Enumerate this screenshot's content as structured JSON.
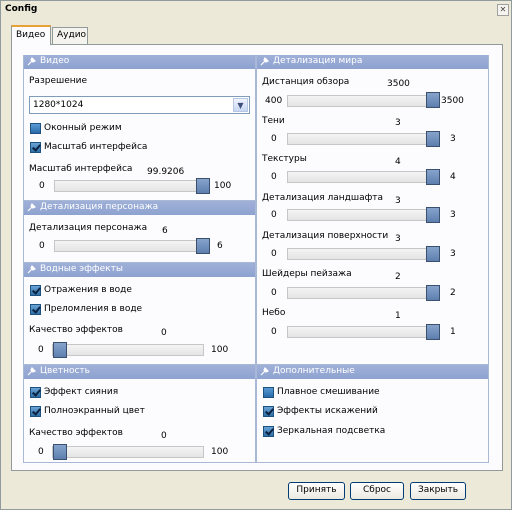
{
  "window": {
    "title": "Config",
    "close_glyph": "✕"
  },
  "tabs": [
    {
      "label": "Видео",
      "active": true
    },
    {
      "label": "Аудио",
      "active": false
    }
  ],
  "video": {
    "header": "Видео",
    "resolution_label": "Разрешение",
    "resolution_value": "1280*1024",
    "windowed_label": "Оконный режим",
    "ui_scale_check_label": "Масштаб интерфейса",
    "ui_scale_slider_label": "Масштаб интерфейса",
    "ui_scale": {
      "value": "99.9206",
      "min": "0",
      "max": "100"
    }
  },
  "character": {
    "header": "Детализация персонажа",
    "label": "Детализация персонажа",
    "slider": {
      "value": "6",
      "min": "0",
      "max": "6"
    }
  },
  "water": {
    "header": "Водные эффекты",
    "reflections_label": "Отражения в воде",
    "refractions_label": "Преломления в воде",
    "quality_label": "Качество эффектов",
    "slider": {
      "value": "0",
      "min": "0",
      "max": "100"
    }
  },
  "color": {
    "header": "Цветность",
    "glow_label": "Эффект сияния",
    "fullscreen_color_label": "Полноэкранный цвет",
    "quality_label": "Качество эффектов",
    "slider": {
      "value": "0",
      "min": "0",
      "max": "100"
    }
  },
  "world": {
    "header": "Детализация мира",
    "view_distance": {
      "label": "Дистанция обзора",
      "value": "3500",
      "min": "400",
      "max": "3500"
    },
    "shadows": {
      "label": "Тени",
      "value": "3",
      "min": "0",
      "max": "3"
    },
    "textures": {
      "label": "Текстуры",
      "value": "4",
      "min": "0",
      "max": "4"
    },
    "landscape": {
      "label": "Детализация ландшафта",
      "value": "3",
      "min": "0",
      "max": "3"
    },
    "surface": {
      "label": "Детализация поверхности",
      "value": "3",
      "min": "0",
      "max": "3"
    },
    "shaders": {
      "label": "Шейдеры пейзажа",
      "value": "2",
      "min": "0",
      "max": "2"
    },
    "sky": {
      "label": "Небо",
      "value": "1",
      "min": "0",
      "max": "1"
    }
  },
  "extra": {
    "header": "Дополнительные",
    "smooth_blend_label": "Плавное смешивание",
    "distortion_label": "Эффекты искажений",
    "mirror_label": "Зеркальная подсветка"
  },
  "buttons": {
    "apply": "Принять",
    "reset": "Сброс",
    "close": "Закрыть"
  },
  "icons": {
    "section_icon": "settings-icon",
    "dropdown": "chevron-down-icon"
  },
  "colors": {
    "section_header": "#8ea2d0",
    "slider_thumb": "#5e7fae",
    "tab_accent": "#e6a239"
  }
}
